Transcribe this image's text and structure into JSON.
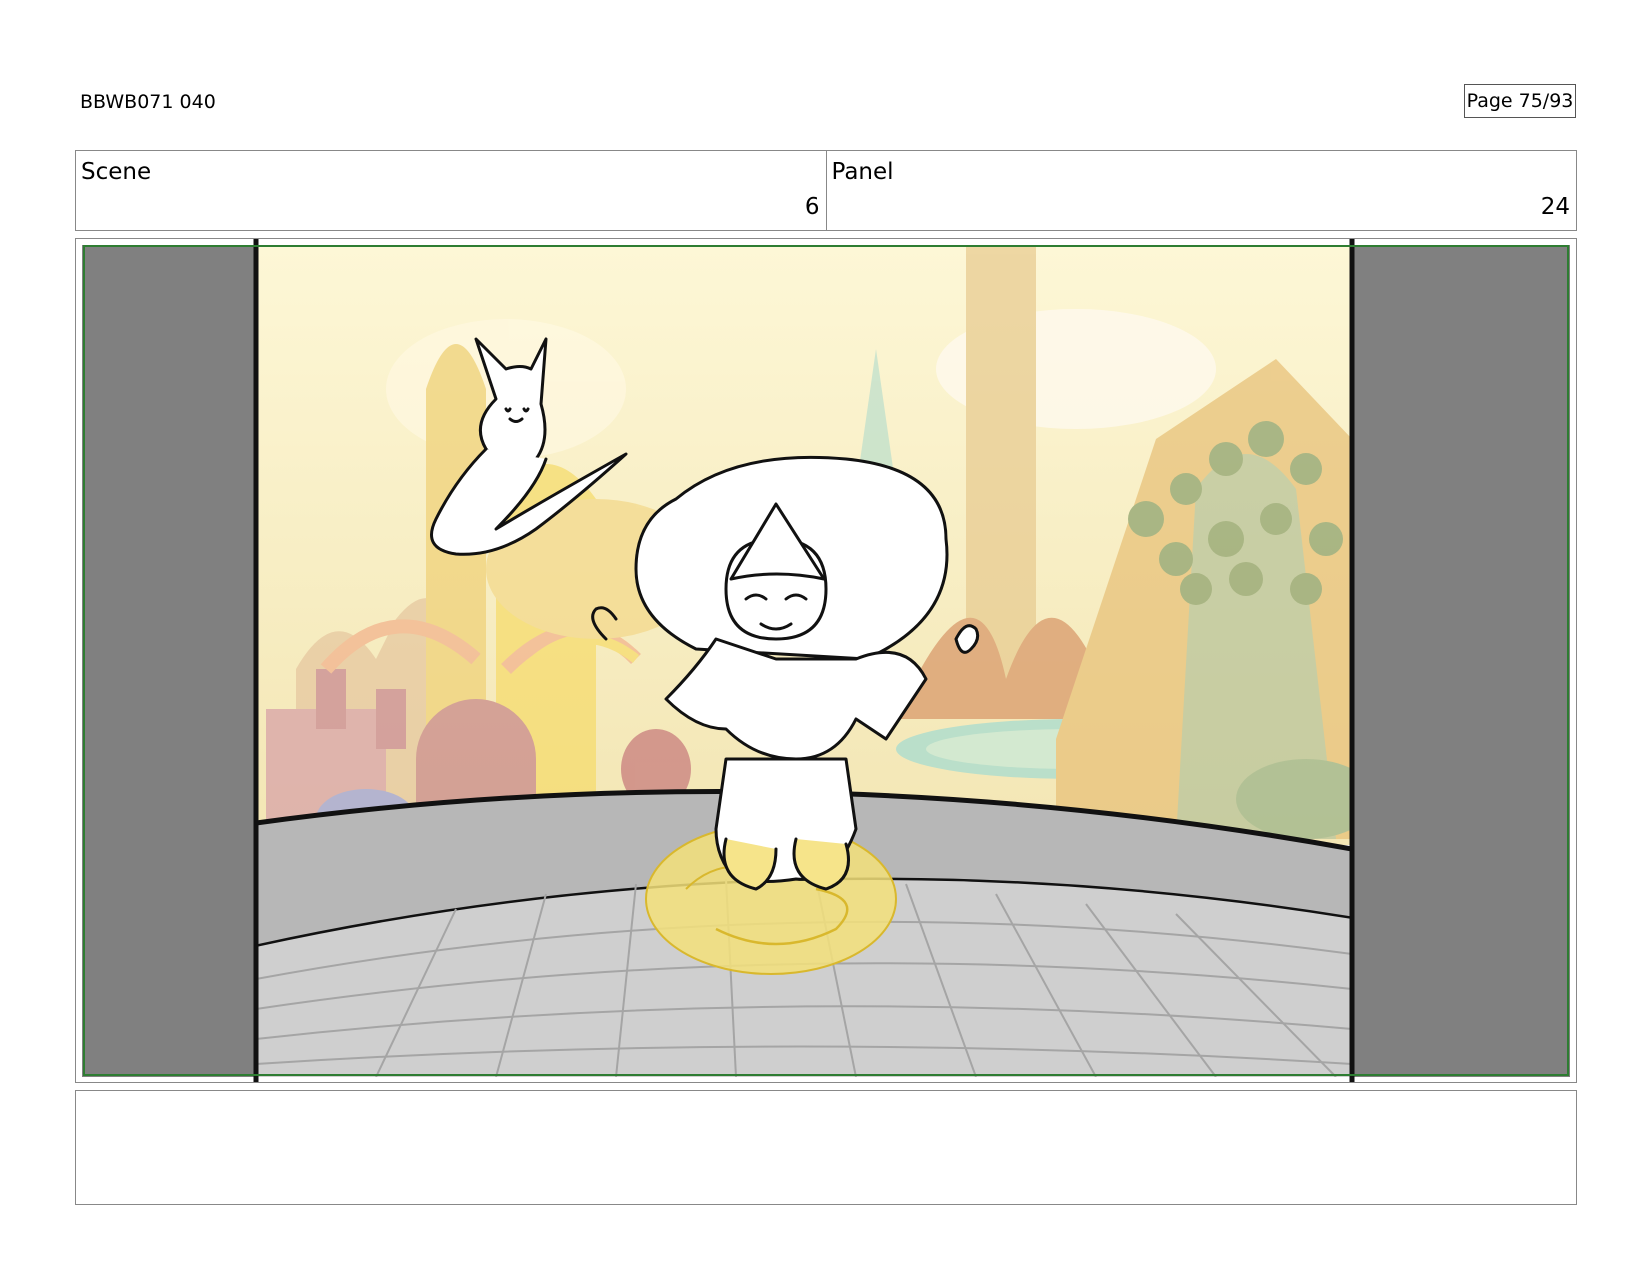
{
  "header": {
    "doc_id": "BBWB071 040",
    "page": "Page 75/93"
  },
  "scene": {
    "label": "Scene",
    "value": "6"
  },
  "panel": {
    "label": "Panel",
    "value": "24"
  },
  "colors": {
    "side_bars": "#808080",
    "safe_frame": "#2e7d32",
    "sky": "#fbf3c8",
    "wall": "#b7b7b7",
    "floor": "#cfcfcf",
    "glow": "#f3e07a"
  },
  "artwork": {
    "characters": [
      "bearded-gnome",
      "floating-ghost-cat"
    ],
    "effects": [
      "yellow-glow-puddle"
    ]
  },
  "notes": {
    "text": ""
  }
}
